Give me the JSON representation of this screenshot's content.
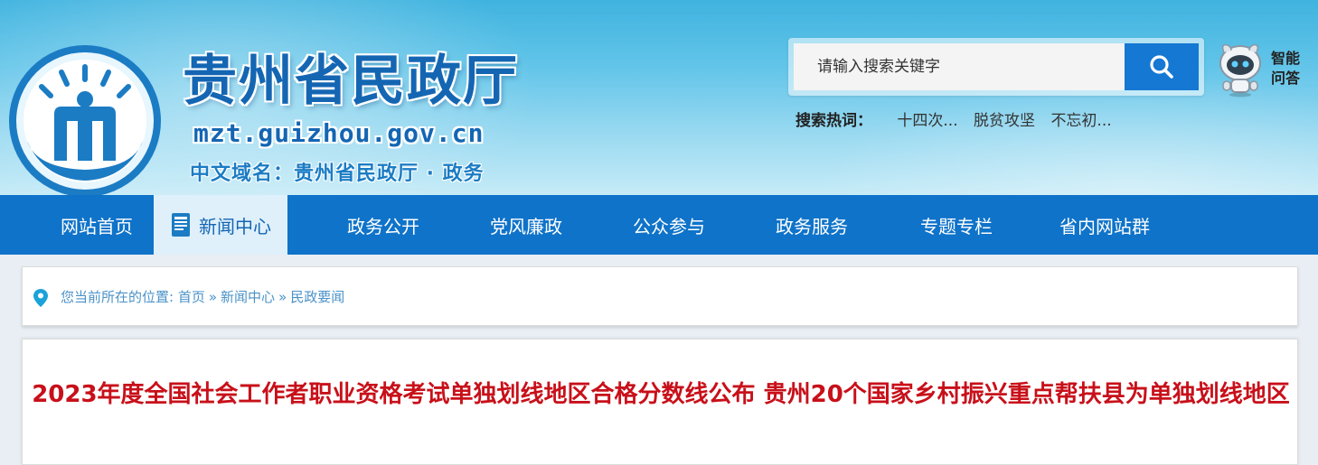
{
  "header": {
    "site_title": "贵州省民政厅",
    "site_domain": "mzt.guizhou.gov.cn",
    "cn_domain": "中文域名：贵州省民政厅 · 政务",
    "search": {
      "placeholder": "请输入搜索关键字"
    },
    "ai_qa": [
      "智能",
      "问答"
    ],
    "hot_search": {
      "label": "搜索热词：",
      "items": [
        "十四次...",
        "脱贫攻坚",
        "不忘初..."
      ]
    }
  },
  "nav": {
    "items": [
      {
        "label": "网站首页",
        "active": false
      },
      {
        "label": "新闻中心",
        "active": true
      },
      {
        "label": "政务公开",
        "active": false
      },
      {
        "label": "党风廉政",
        "active": false
      },
      {
        "label": "公众参与",
        "active": false
      },
      {
        "label": "政务服务",
        "active": false
      },
      {
        "label": "专题专栏",
        "active": false
      },
      {
        "label": "省内网站群",
        "active": false
      }
    ]
  },
  "breadcrumb": {
    "prefix": "您当前所在的位置:",
    "items": [
      "首页",
      "新闻中心",
      "民政要闻"
    ],
    "separator": "»"
  },
  "article": {
    "title": "2023年度全国社会工作者职业资格考试单独划线地区合格分数线公布 贵州20个国家乡村振兴重点帮扶县为单独划线地区"
  },
  "icons": {
    "logo": "minzheng-logo",
    "search": "search-icon",
    "robot": "robot-icon",
    "news_doc": "document-icon",
    "location": "location-pin-icon"
  },
  "colors": {
    "nav_bg": "#0f73c9",
    "nav_active_bg": "#dff0fb",
    "title_blue": "#1466b3",
    "article_title_red": "#c8101a",
    "breadcrumb_blue": "#4a92c8",
    "search_button": "#1578d3"
  }
}
